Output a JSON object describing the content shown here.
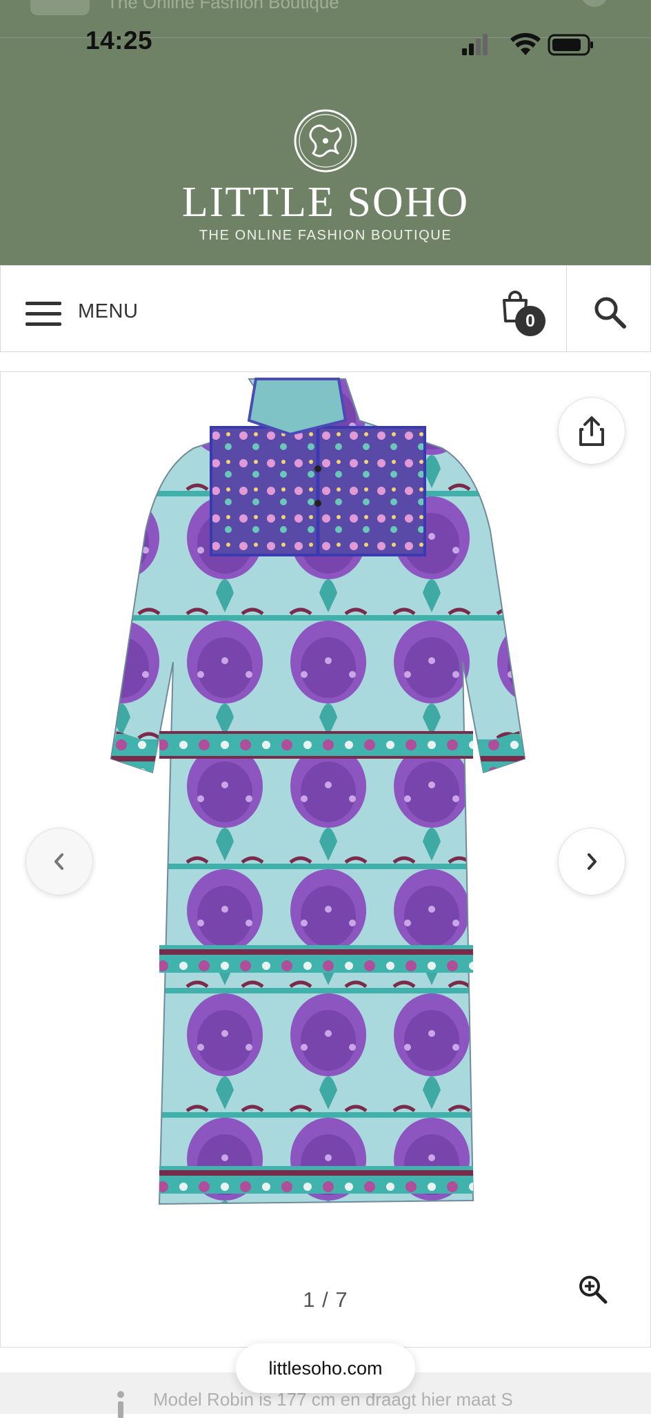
{
  "browser": {
    "prev_tab_title": "The Online Fashion Boutique",
    "url": "littlesoho.com"
  },
  "status_bar": {
    "time": "14:25",
    "icons": [
      "cellular-signal-icon",
      "wifi-icon",
      "battery-icon"
    ]
  },
  "header": {
    "logo_mark": "LS",
    "brand_name": "LITTLE SOHO",
    "tagline": "THE ONLINE FASHION BOUTIQUE",
    "background_color": "#6f8266"
  },
  "nav": {
    "menu_label": "MENU",
    "cart_count": "0",
    "icons": [
      "hamburger-icon",
      "shopping-bag-icon",
      "search-icon"
    ]
  },
  "gallery": {
    "current_image": 1,
    "total_images": 7,
    "counter": "1 / 7",
    "image_description_icon": "printed-peacock-dress",
    "controls": [
      "share-icon",
      "chevron-left-icon",
      "chevron-right-icon",
      "zoom-in-icon"
    ],
    "palette": {
      "base": "#a8d8dc",
      "teal": "#3aaba6",
      "purple": "#8a4fb8",
      "maroon": "#7a2a4a"
    }
  },
  "below_fold": {
    "info_text": "Model Robin is 177 cm en draagt hier maat S"
  }
}
